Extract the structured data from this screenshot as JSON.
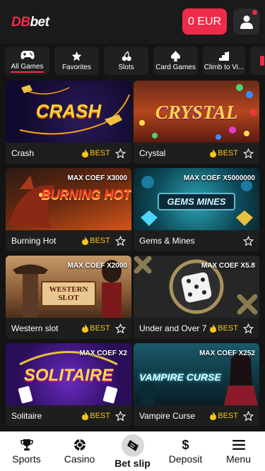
{
  "header": {
    "logo_prefix": "DB",
    "logo_suffix": "bet",
    "balance_label": "0 EUR"
  },
  "categories": [
    {
      "label": "All Games",
      "icon": "gamepad-icon",
      "active": true
    },
    {
      "label": "Favorites",
      "icon": "star-icon",
      "active": false
    },
    {
      "label": "Slots",
      "icon": "cherry-icon",
      "active": false
    },
    {
      "label": "Card Games",
      "icon": "spade-icon",
      "active": false
    },
    {
      "label": "Climb to Vi...",
      "icon": "stairs-icon",
      "active": false
    }
  ],
  "games": [
    {
      "name": "Crash",
      "badge": "BEST",
      "coef": "",
      "art": "CRASH"
    },
    {
      "name": "Crystal",
      "badge": "BEST",
      "coef": "",
      "art": "CRYSTAL"
    },
    {
      "name": "Burning Hot",
      "badge": "BEST",
      "coef": "MAX COEF X3000",
      "art": "BURNING HOT"
    },
    {
      "name": "Gems & Mines",
      "badge": "",
      "coef": "MAX COEF X5000000",
      "art": "GEMS MINES"
    },
    {
      "name": "Western slot",
      "badge": "BEST",
      "coef": "MAX COEF X2000",
      "art": "WESTERN SLOT"
    },
    {
      "name": "Under and Over 7",
      "badge": "BEST",
      "coef": "MAX COEF X5.8",
      "art": ""
    },
    {
      "name": "Solitaire",
      "badge": "BEST",
      "coef": "MAX COEF X2",
      "art": "SOLITAIRE"
    },
    {
      "name": "Vampire Curse",
      "badge": "BEST",
      "coef": "MAX COEF X252",
      "art": "VAMPIRE CURSE"
    }
  ],
  "bottom_nav": [
    {
      "label": "Sports",
      "icon": "trophy-icon"
    },
    {
      "label": "Casino",
      "icon": "casino-chip-icon"
    },
    {
      "label": "Bet slip",
      "icon": "ticket-icon"
    },
    {
      "label": "Deposit",
      "icon": "dollar-icon"
    },
    {
      "label": "Menu",
      "icon": "hamburger-icon"
    }
  ],
  "colors": {
    "accent": "#ee2b4a",
    "best": "#f5c518",
    "background": "#141414"
  }
}
